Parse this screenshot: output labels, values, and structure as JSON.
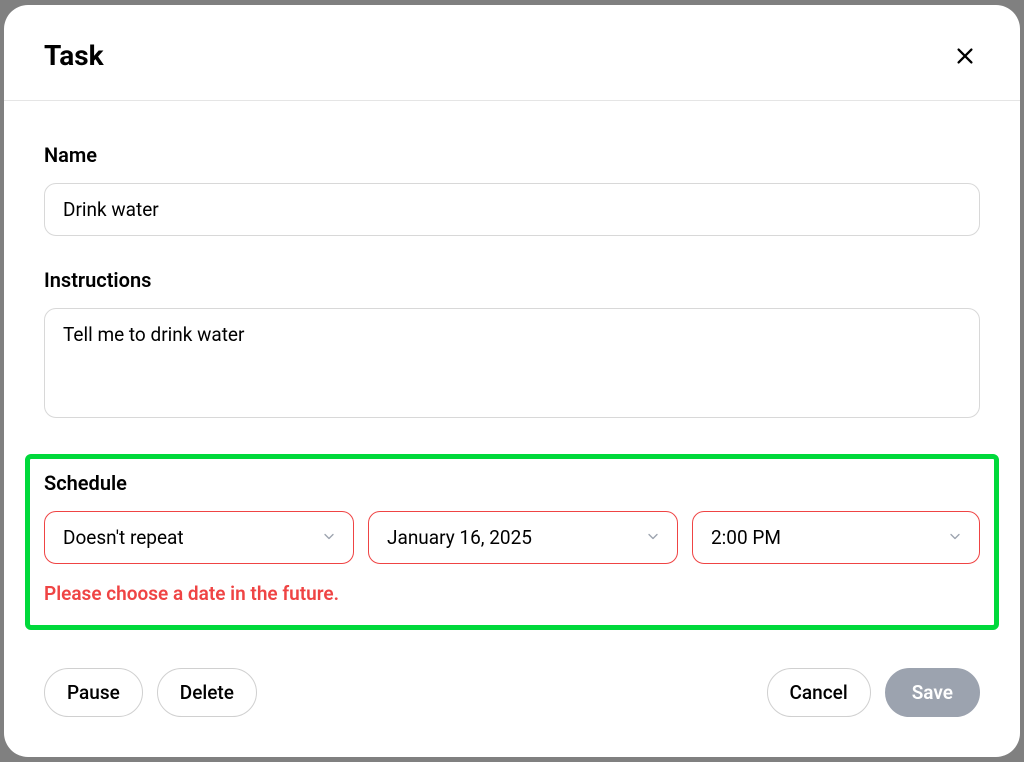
{
  "header": {
    "title": "Task"
  },
  "fields": {
    "name_label": "Name",
    "name_value": "Drink water",
    "instructions_label": "Instructions",
    "instructions_value": "Tell me to drink water",
    "schedule_label": "Schedule"
  },
  "schedule": {
    "repeat_value": "Doesn't repeat",
    "date_value": "January 16, 2025",
    "time_value": "2:00 PM",
    "error_text": "Please choose a date in the future."
  },
  "footer": {
    "pause_label": "Pause",
    "delete_label": "Delete",
    "cancel_label": "Cancel",
    "save_label": "Save"
  }
}
